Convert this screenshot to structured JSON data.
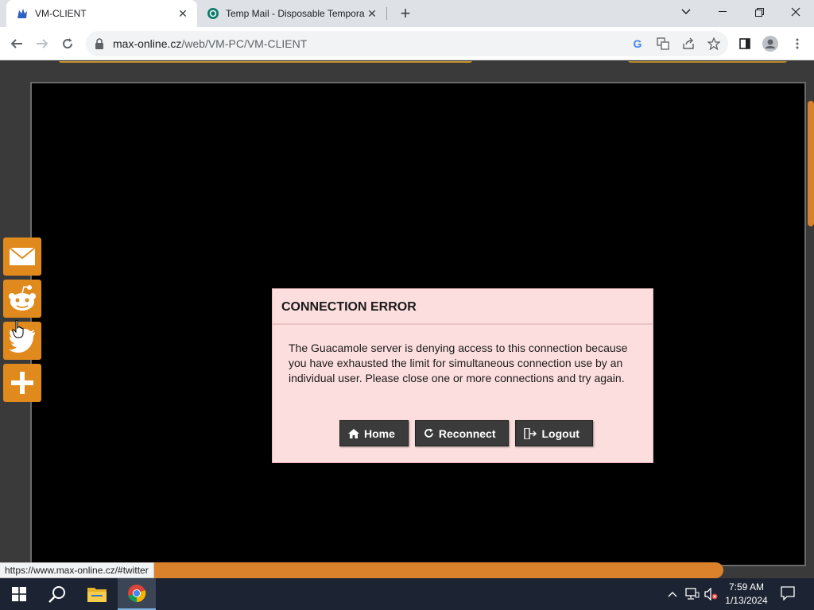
{
  "browser": {
    "tabs": [
      {
        "title": "VM-CLIENT",
        "favicon": "wolf-logo-icon",
        "active": true
      },
      {
        "title": "Temp Mail - Disposable Tempora",
        "favicon": "tempmail-icon",
        "active": false
      }
    ],
    "url_host": "max-online.cz",
    "url_path": "/web/VM-PC/VM-CLIENT"
  },
  "share_buttons": [
    {
      "name": "email",
      "icon": "envelope-icon"
    },
    {
      "name": "reddit",
      "icon": "reddit-icon"
    },
    {
      "name": "twitter",
      "icon": "twitter-icon"
    },
    {
      "name": "more",
      "icon": "plus-icon"
    }
  ],
  "dialog": {
    "title": "CONNECTION ERROR",
    "message": "The Guacamole server is denying access to this connection because you have exhausted the limit for simultaneous connection use by an individual user. Please close one or more connections and try again.",
    "buttons": {
      "home": "Home",
      "reconnect": "Reconnect",
      "logout": "Logout"
    }
  },
  "status_bar_url": "https://www.max-online.cz/#twitter",
  "taskbar": {
    "time": "7:59 AM",
    "date": "1/13/2024"
  },
  "colors": {
    "accent_orange": "#d9822b",
    "dialog_bg": "#fddede",
    "button_bg": "#3b3b3b"
  }
}
